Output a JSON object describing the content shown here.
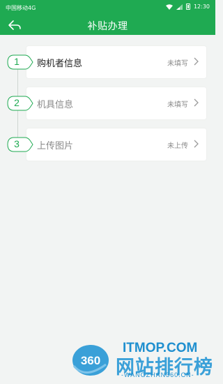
{
  "status_bar": {
    "carrier": "中国移动4G",
    "time": "12:30",
    "icons": [
      "wifi-icon",
      "signal-icon",
      "battery-icon"
    ]
  },
  "header": {
    "title": "补贴办理",
    "back_icon": "back-arrow-icon"
  },
  "steps": [
    {
      "number": "1",
      "label": "购机者信息",
      "status": "未填写"
    },
    {
      "number": "2",
      "label": "机具信息",
      "status": "未填写"
    },
    {
      "number": "3",
      "label": "上传图片",
      "status": "未上传"
    }
  ],
  "watermark": {
    "logo_text": "360",
    "brand": "网站排行榜",
    "site": "ITMOP.COM",
    "url": "-WANGZHAN360.CN-"
  },
  "colors": {
    "primary": "#1faa52",
    "background": "#f2f4f3",
    "card": "#ffffff",
    "muted_text": "#8a8a8a",
    "watermark": "#3aa0d8"
  }
}
